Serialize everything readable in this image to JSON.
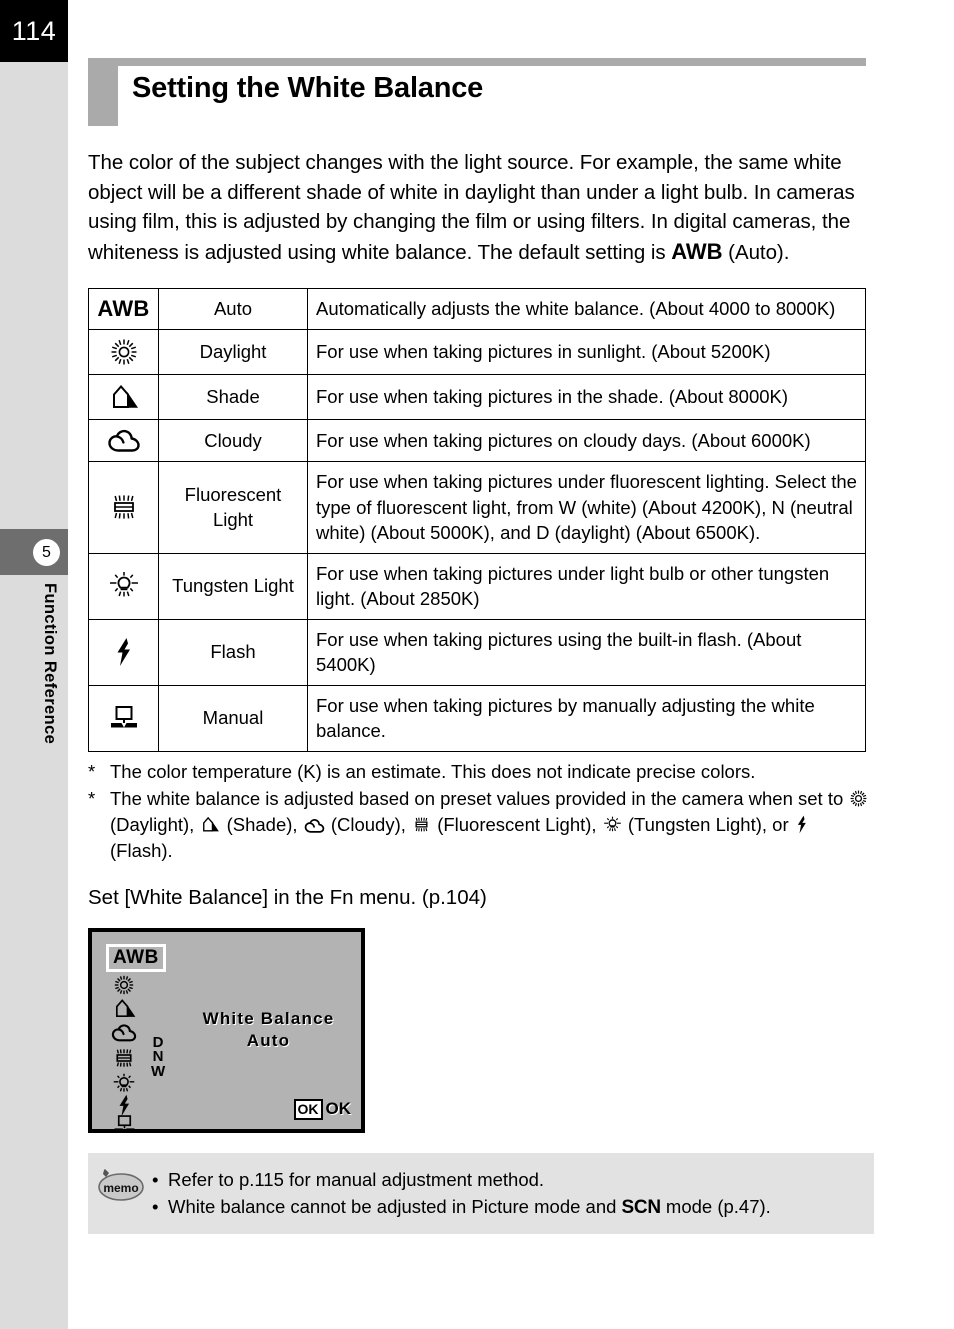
{
  "page": {
    "number": "114",
    "chapter_badge": "5",
    "chapter_title": "Function Reference"
  },
  "heading": {
    "title": "Setting the White Balance"
  },
  "intro": {
    "part1": "The color of the subject changes with the light source. For example, the same white object will be a different shade of white in daylight than under a light bulb. In cameras using film, this is adjusted by changing the film or using filters. In digital cameras, the whiteness is adjusted using white balance. The default setting is ",
    "awb": "AWB",
    "part2": " (Auto)."
  },
  "table": {
    "rows": [
      {
        "icon": "awb-text-icon",
        "icon_text": "AWB",
        "name": "Auto",
        "desc": "Automatically adjusts the white balance. (About 4000 to 8000K)"
      },
      {
        "icon": "sun-daylight-icon",
        "icon_text": "",
        "name": "Daylight",
        "desc": "For use when taking pictures in sunlight. (About 5200K)"
      },
      {
        "icon": "house-shade-icon",
        "icon_text": "",
        "name": "Shade",
        "desc": "For use when taking pictures in the shade. (About 8000K)"
      },
      {
        "icon": "cloud-cloudy-icon",
        "icon_text": "",
        "name": "Cloudy",
        "desc": "For use when taking pictures on cloudy days. (About 6000K)"
      },
      {
        "icon": "fluorescent-tube-icon",
        "icon_text": "",
        "name": "Fluorescent Light",
        "desc": "For use when taking pictures under fluorescent lighting. Select the type of fluorescent light, from W (white) (About 4200K), N (neutral white) (About 5000K), and D (daylight) (About 6500K)."
      },
      {
        "icon": "lightbulb-tungsten-icon",
        "icon_text": "",
        "name": "Tungsten Light",
        "desc": "For use when taking pictures under light bulb or other tungsten light. (About 2850K)"
      },
      {
        "icon": "flash-bolt-icon",
        "icon_text": "",
        "name": "Flash",
        "desc": "For use when taking pictures using the built-in flash. (About 5400K)"
      },
      {
        "icon": "manual-screen-icon",
        "icon_text": "",
        "name": "Manual",
        "desc": "For use when taking pictures by manually adjusting the white balance."
      }
    ]
  },
  "footnotes": {
    "marker": "*",
    "note1": "The color temperature (K) is an estimate. This does not indicate precise colors.",
    "note2": {
      "lead": "The white balance is adjusted based on preset values provided in the camera when set to ",
      "daylight_label": "(Daylight), ",
      "shade_label": "(Shade), ",
      "cloudy_label": "(Cloudy), ",
      "fluorescent_label": "(Fluorescent Light), ",
      "tungsten_label": "(Tungsten Light), or ",
      "flash_label": "(Flash)."
    }
  },
  "set_line": "Set [White Balance] in the Fn menu. (p.104)",
  "lcd": {
    "awb_badge": "AWB",
    "dnw": "D\nN\nW",
    "title_line1": "White Balance",
    "title_line2": "Auto",
    "ok_box": "OK",
    "ok_label": "OK",
    "icons": [
      "sun-daylight-icon",
      "house-shade-icon",
      "cloud-cloudy-icon",
      "fluorescent-tube-icon",
      "lightbulb-tungsten-icon",
      "flash-bolt-icon",
      "manual-screen-icon"
    ]
  },
  "memo": {
    "icon_label": "memo",
    "bullet": "•",
    "line1": "Refer to p.115 for manual adjustment method.",
    "line2_pre": "White balance cannot be adjusted in Picture mode and ",
    "line2_scn": "SCN",
    "line2_post": " mode (p.47)."
  },
  "colors": {
    "page_number_bg": "#000000",
    "sidebar_bg": "#dcdcdc",
    "chapter_tab_bg": "#6e6e6e",
    "heading_bar": "#aaaaaa",
    "lcd_bg": "#b3b3b3",
    "memo_bg": "#e2e2e2"
  }
}
